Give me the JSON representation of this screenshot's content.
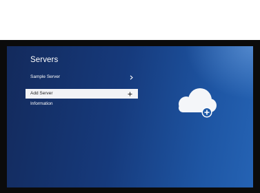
{
  "screen": {
    "title": "Servers"
  },
  "menu": {
    "items": [
      {
        "label": "Sample Server",
        "icon": "chevron-right-icon"
      },
      {
        "label": "Add Server",
        "icon": "plus-icon",
        "selected": true
      },
      {
        "label": "Information"
      }
    ]
  },
  "illustration": {
    "icon": "cloud-add-icon"
  },
  "colors": {
    "background_dark": "#132a5c",
    "background_light": "#2563b4",
    "selected_row": "#f2f3f6",
    "accent_badge": "#1e5aa8"
  }
}
